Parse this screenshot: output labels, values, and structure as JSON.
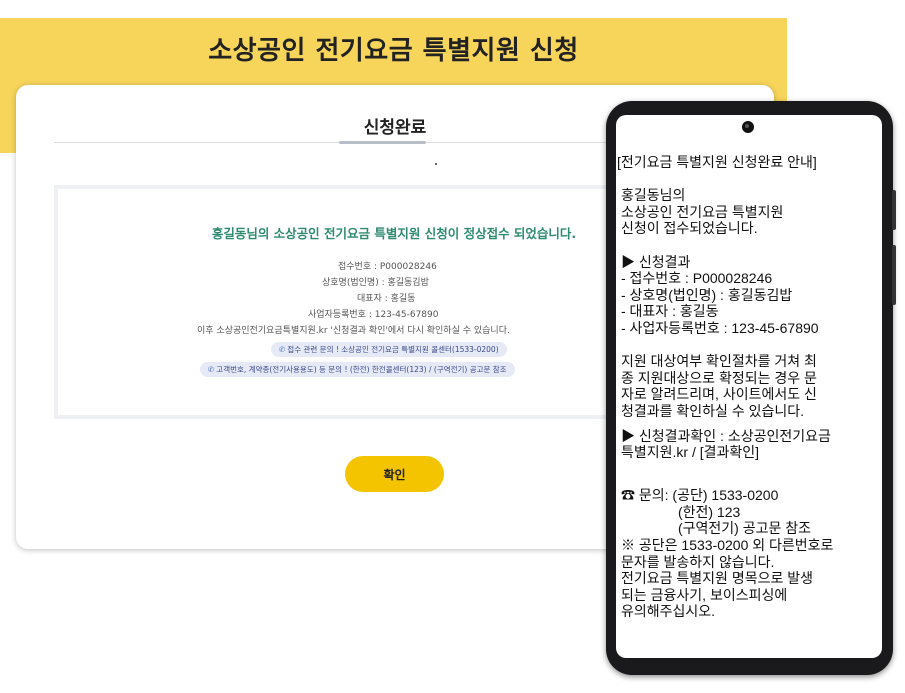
{
  "banner": {
    "title": "소상공인 전기요금 특별지원 신청"
  },
  "card": {
    "title": "신청완료",
    "dot": ".",
    "success_message": "홍길동님의 소상공인 전기요금 특별지원 신청이 정상접수 되었습니다.",
    "receipt_no": "접수번호 : P000028246",
    "business_name": "상호명(법인명) : 홍길동김밥",
    "representative": "대표자 : 홍길동",
    "business_reg_no": "사업자등록번호 : 123-45-67890",
    "followup": "이후 소상공인전기요금특별지원.kr '신청결과 확인'에서 다시 확인하실 수 있습니다.",
    "contact_pill_1": "접수 관련 문의 ! 소상공인 전기요금 특별지원 콜센터(1533-0200)",
    "contact_pill_2": "고객번호, 계약종(전기사용용도) 등 문의 ! (한전) 한전콜센터(123) / (구역전기) 공고문 참조",
    "phone_icon": "phone-icon",
    "confirm_label": "확인"
  },
  "sms": {
    "header": "[전기요금 특별지원 신청완료 안내]",
    "greeting_1": "홍길동님의",
    "greeting_2": "소상공인 전기요금 특별지원",
    "greeting_3": "신청이 접수되었습니다.",
    "result_title": "▶ 신청결과",
    "result_1": "-    접수번호 : P000028246",
    "result_2": "-    상호명(법인명) : 홍길동김밥",
    "result_3": "-    대표자 : 홍길동",
    "result_4": "-    사업자등록번호 : 123-45-67890",
    "notice_1": "지원 대상여부 확인절차를 거쳐 최",
    "notice_2": "종 지원대상으로 확정되는 경우 문",
    "notice_3": "자로 알려드리며, 사이트에서도 신",
    "notice_4": "청결과를 확인하실 수 있습니다.",
    "check_1": "▶ 신청결과확인 : 소상공인전기요금",
    "check_2": "특별지원.kr / [결과확인]",
    "inquiry_1": "☎ 문의: (공단) 1533-0200",
    "inquiry_2": "(한전) 123",
    "inquiry_3": "(구역전기) 공고문 참조",
    "warning_1": "※ 공단은 1533-0200 외 다른번호로",
    "warning_2": "문자를 발송하지 않습니다.",
    "warning_3": "전기요금 특별지원 명목으로 발생",
    "warning_4": "되는 금융사기, 보이스피싱에",
    "warning_5": "유의해주십시오."
  },
  "colors": {
    "banner": "#f7d55b",
    "accent_green": "#2e8b6f",
    "button": "#f5c400",
    "pill_bg": "#e6e9f6"
  }
}
